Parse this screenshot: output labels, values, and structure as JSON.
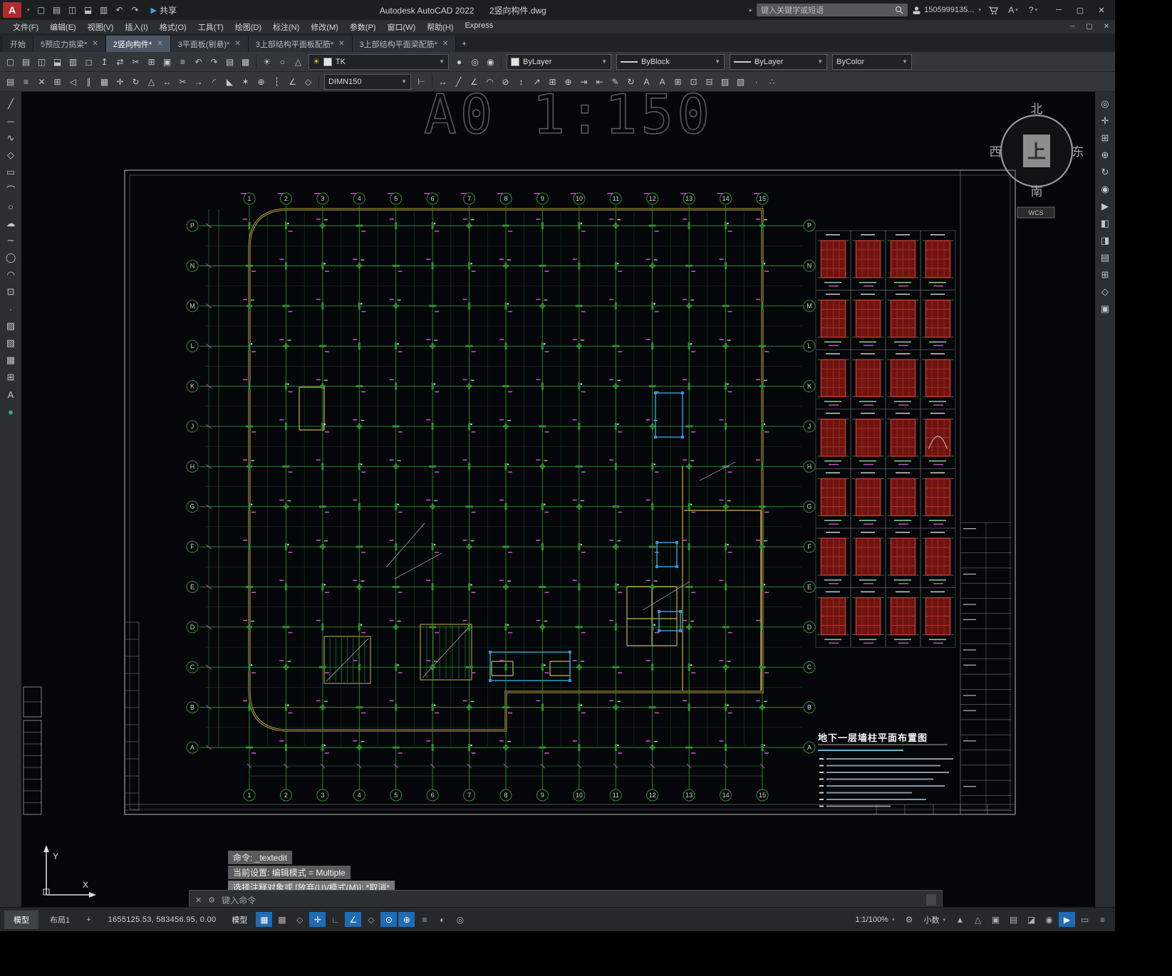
{
  "titlebar": {
    "app_title": "Autodesk AutoCAD 2022",
    "doc_title": "2竖向构件.dwg",
    "share_label": "共享",
    "search_placeholder": "键入关键字或短语",
    "user_name": "1505999135...",
    "autodesk_app_label": "A",
    "help_label": "?",
    "quick_access": [
      "new-file",
      "open-file",
      "save",
      "save-as",
      "print",
      "undo",
      "redo"
    ],
    "controls": {
      "minimize": "─",
      "maximize": "▢",
      "close": "✕"
    }
  },
  "menubar": {
    "items": [
      "文件(F)",
      "编辑(E)",
      "视图(V)",
      "插入(I)",
      "格式(O)",
      "工具(T)",
      "绘图(D)",
      "标注(N)",
      "修改(M)",
      "参数(P)",
      "窗口(W)",
      "帮助(H)",
      "Express"
    ]
  },
  "filetabs": {
    "start_tab": "开始",
    "tabs": [
      {
        "label": "5预应力挑梁*",
        "active": false
      },
      {
        "label": "2竖向构件*",
        "active": true
      },
      {
        "label": "3平面板(剔悬)*",
        "active": false
      },
      {
        "label": "3上部结构平面板配筋*",
        "active": false
      },
      {
        "label": "3上部结构平面梁配筋*",
        "active": false
      }
    ],
    "new_tab": "+"
  },
  "ribbon": {
    "row1_icons": [
      "qnew",
      "open",
      "save",
      "saveas",
      "plot",
      "plot-preview",
      "publish",
      "etransmit",
      "cut",
      "copy",
      "paste",
      "match-properties",
      "undo",
      "redo",
      "layer-previous",
      "layer-states"
    ],
    "layer_pre_icons": [
      "layer-on",
      "layer-freeze",
      "layer-lock"
    ],
    "layer_value": "TK",
    "layer_post_icons": [
      "layer-off",
      "layer-isolate",
      "layer-unisolate"
    ],
    "color_value": "ByLayer",
    "linetype_value": "ByBlock",
    "lineweight_value": "ByLayer",
    "plotstyle_value": "ByColor",
    "row2_icons_a": [
      "properties",
      "match",
      "erase",
      "copy-obj",
      "mirror",
      "offset",
      "array",
      "move",
      "rotate",
      "scale",
      "stretch",
      "trim",
      "extend",
      "fillet",
      "chamfer",
      "explode",
      "join",
      "break",
      "measure",
      "quick-select"
    ],
    "dimstyle_value": "DIMN150",
    "row2_icons_b": [
      "dim-linear",
      "dim-aligned",
      "dim-angular",
      "dim-radius",
      "dim-diameter",
      "dim-ordinate",
      "qleader",
      "tolerance",
      "center-mark",
      "dim-continue",
      "dim-baseline",
      "dim-edit",
      "dim-update",
      "text-single",
      "text-multi",
      "table",
      "block-insert",
      "block-create",
      "hatch-tool",
      "gradient-tool",
      "point-tool",
      "divide"
    ]
  },
  "left_tools": [
    "line",
    "xline",
    "polyline",
    "polygon",
    "rectangle",
    "arc",
    "circle",
    "revcloud",
    "spline",
    "ellipse",
    "ellipse-arc",
    "block-insert",
    "point",
    "hatch",
    "gradient",
    "region",
    "table",
    "text",
    "palette"
  ],
  "right_tools": [
    "fullscreen-nav",
    "pan",
    "zoom-window",
    "zoom-extents",
    "orbit",
    "steering-wheel",
    "show-motion",
    "view-back",
    "view-front",
    "named-views",
    "windows-tile",
    "perspective",
    "camera"
  ],
  "drawing": {
    "ghost_text": "A0  1:150",
    "wcs_label": "WCS",
    "compass": {
      "north": "北",
      "south": "南",
      "west": "西",
      "east": "东",
      "up": "上"
    },
    "grid": {
      "col_labels": [
        "1",
        "2",
        "3",
        "4",
        "5",
        "6",
        "7",
        "8",
        "9",
        "10",
        "11",
        "12",
        "13",
        "14",
        "15"
      ],
      "row_labels": [
        "P",
        "N",
        "M",
        "L",
        "K",
        "J",
        "H",
        "G",
        "F",
        "E",
        "D",
        "C",
        "B",
        "A"
      ]
    },
    "title_block": {
      "drawing_title": "地下一层墙柱平面布置图"
    },
    "ucs": {
      "x_label": "X",
      "y_label": "Y"
    },
    "colors": {
      "grid_green": "#2f8f2f",
      "sub_green": "#1b4a1b",
      "wall_yellow": "#c9b542",
      "detail_red": "#c23a30",
      "detail_red_dark": "#6e1410",
      "magenta": "#c34ec3",
      "cyan_selection": "#2fb3e8",
      "white_line": "#cfcfcf",
      "ghost": "#585858"
    }
  },
  "command": {
    "history": [
      "命令: _textedit",
      "当前设置: 编辑模式 = Multiple",
      "选择注释对象或 [放弃(U)/模式(M)]: *取消*"
    ],
    "input_placeholder": "键入命令"
  },
  "statusbar": {
    "model_tab": "模型",
    "layout_tab": "布局1",
    "new_layout": "+",
    "coordinates": "1655125.53, 583456.95, 0.00",
    "model_button": "模型",
    "left_icons": [
      {
        "n": "grid",
        "a": true
      },
      {
        "n": "snap-mode",
        "a": false
      },
      {
        "n": "infer-constraints",
        "a": false
      },
      {
        "n": "dynamic-input",
        "a": true
      },
      {
        "n": "ortho",
        "a": false
      },
      {
        "n": "polar-tracking",
        "a": true
      },
      {
        "n": "isometric-drafting",
        "a": false
      },
      {
        "n": "object-snap-tracking",
        "a": true
      },
      {
        "n": "object-snap",
        "a": true
      },
      {
        "n": "lineweight-display",
        "a": false
      },
      {
        "n": "transparency",
        "a": false
      },
      {
        "n": "selection-cycling",
        "a": false
      }
    ],
    "scale_label": "1:1/100%",
    "units_label": "小数",
    "right_icons": [
      {
        "n": "annotation-visibility",
        "a": false
      },
      {
        "n": "autoscale",
        "a": false
      },
      {
        "n": "annotation-monitor",
        "a": false
      },
      {
        "n": "quick-properties",
        "a": false
      },
      {
        "n": "lock-ui",
        "a": false
      },
      {
        "n": "isolate-objects",
        "a": false
      },
      {
        "n": "graphics-performance",
        "a": true
      },
      {
        "n": "clean-screen",
        "a": false
      },
      {
        "n": "customization",
        "a": false
      }
    ]
  }
}
